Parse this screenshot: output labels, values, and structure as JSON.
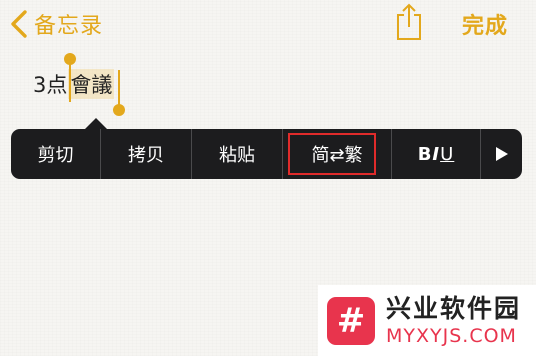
{
  "nav": {
    "back_label": "备忘录",
    "done_label": "完成"
  },
  "note": {
    "prefix": "3点",
    "selected": "會議"
  },
  "edit_menu": {
    "items": [
      "剪切",
      "拷贝",
      "粘贴",
      "简⇄繁"
    ],
    "format_b": "B",
    "format_i": "I",
    "format_u": "U",
    "more_icon": "play-triangle"
  },
  "colors": {
    "accent": "#e3a81c",
    "menu_bg": "#1c1c1e",
    "highlight": "#e02b2b"
  },
  "watermark": {
    "logo_glyph": "#",
    "title": "兴业软件园",
    "domain": "MYXYJS.COM"
  }
}
